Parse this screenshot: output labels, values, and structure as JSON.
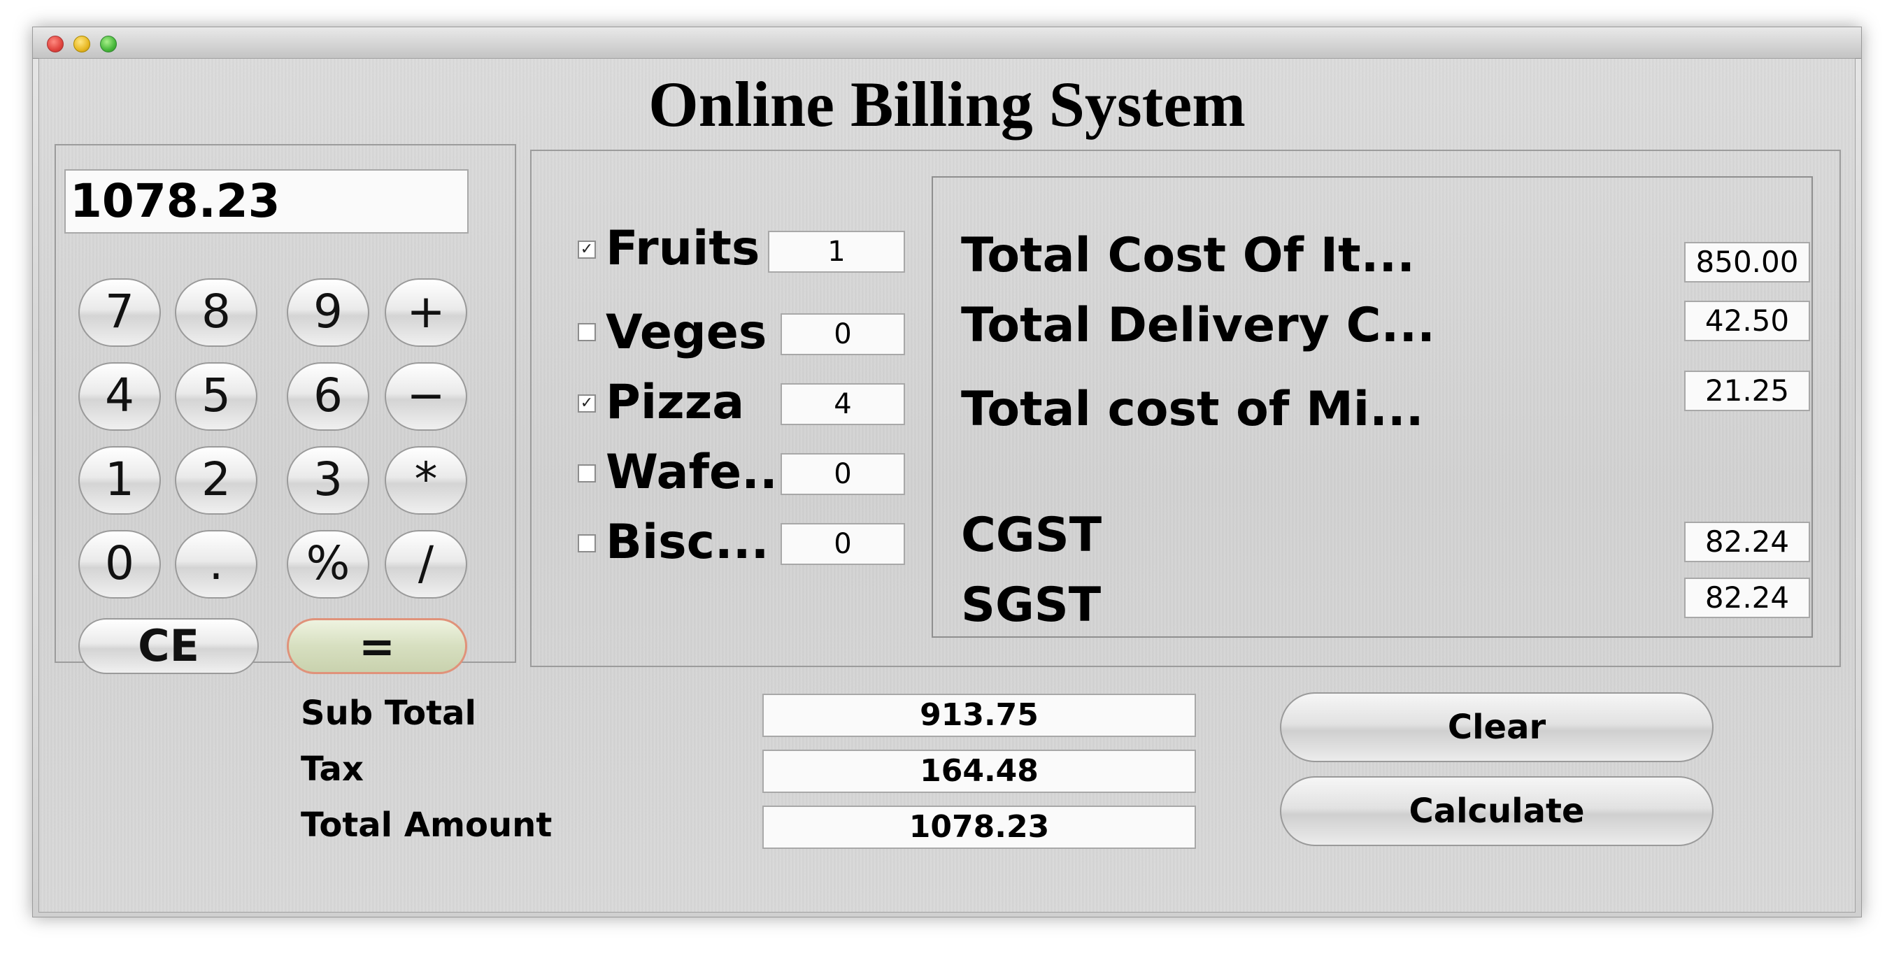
{
  "app": {
    "title": "Online Billing System"
  },
  "calculator": {
    "display": "1078.23",
    "keys": {
      "k7": "7",
      "k8": "8",
      "k9": "9",
      "plus": "+",
      "k4": "4",
      "k5": "5",
      "k6": "6",
      "minus": "−",
      "k1": "1",
      "k2": "2",
      "k3": "3",
      "multiply": "*",
      "k0": "0",
      "dot": ".",
      "percent": "%",
      "divide": "/",
      "ce": "CE",
      "equals": "="
    }
  },
  "items": [
    {
      "label": "Fruits",
      "checked": true,
      "qty": "1"
    },
    {
      "label": "Veges",
      "checked": false,
      "qty": "0"
    },
    {
      "label": "Pizza",
      "checked": true,
      "qty": "4"
    },
    {
      "label": "Wafe...",
      "checked": false,
      "qty": "0"
    },
    {
      "label": "Bisc...",
      "checked": false,
      "qty": "0"
    }
  ],
  "costs": {
    "items_label": "Total Cost Of It...",
    "items_value": "850.00",
    "delivery_label": "Total Delivery C...",
    "delivery_value": "42.50",
    "misc_label": "Total cost of Mi...",
    "misc_value": "21.25",
    "cgst_label": "CGST",
    "cgst_value": "82.24",
    "sgst_label": "SGST",
    "sgst_value": "82.24"
  },
  "summary": {
    "subtotal_label": "Sub Total",
    "subtotal_value": "913.75",
    "tax_label": "Tax",
    "tax_value": "164.48",
    "total_label": "Total Amount",
    "total_value": "1078.23"
  },
  "buttons": {
    "clear": "Clear",
    "calculate": "Calculate"
  },
  "checkmark": "✓"
}
